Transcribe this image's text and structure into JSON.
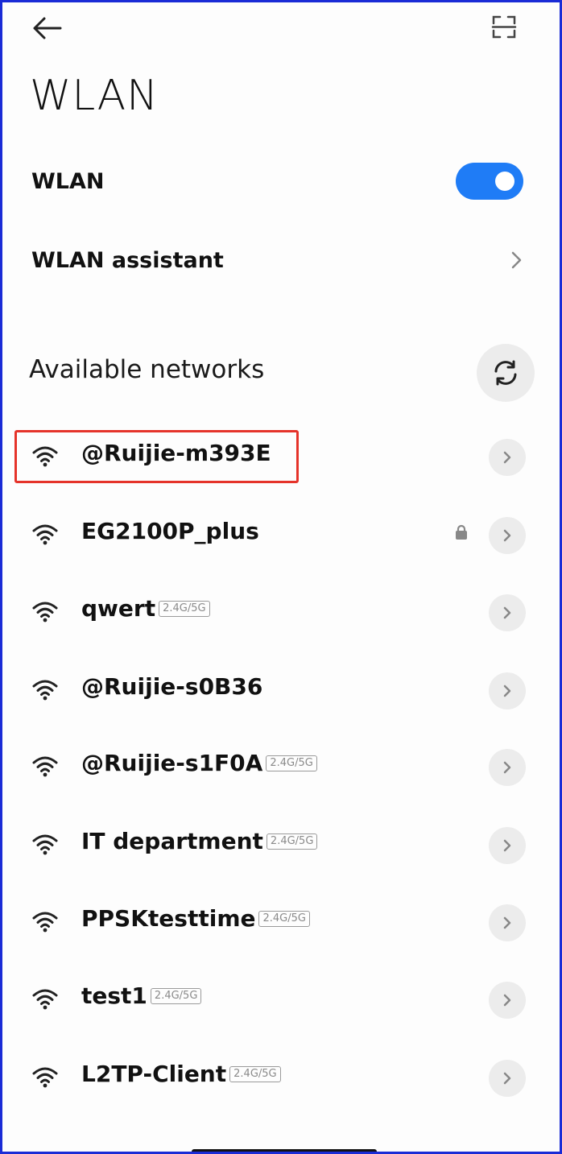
{
  "page": {
    "title": "WLAN"
  },
  "wlan_toggle": {
    "label": "WLAN",
    "on": true
  },
  "assistant": {
    "label": "WLAN assistant"
  },
  "available": {
    "title": "Available networks"
  },
  "networks": [
    {
      "name": "@Ruijie-m393E",
      "band": "",
      "locked": false,
      "highlighted": true
    },
    {
      "name": "EG2100P_plus",
      "band": "",
      "locked": true,
      "highlighted": false
    },
    {
      "name": "qwert",
      "band": "2.4G/5G",
      "locked": false,
      "highlighted": false
    },
    {
      "name": "@Ruijie-s0B36",
      "band": "",
      "locked": false,
      "highlighted": false
    },
    {
      "name": "@Ruijie-s1F0A",
      "band": "2.4G/5G",
      "locked": false,
      "highlighted": false
    },
    {
      "name": "IT department",
      "band": "2.4G/5G",
      "locked": false,
      "highlighted": false
    },
    {
      "name": "PPSKtesttime",
      "band": "2.4G/5G",
      "locked": false,
      "highlighted": false
    },
    {
      "name": "test1",
      "band": "2.4G/5G",
      "locked": false,
      "highlighted": false
    },
    {
      "name": "L2TP-Client",
      "band": "2.4G/5G",
      "locked": false,
      "highlighted": false
    }
  ],
  "colors": {
    "accent": "#1f7cf6",
    "highlight": "#e5332a",
    "frame": "#1a2bd6"
  },
  "icons": {
    "back": "arrow-left-icon",
    "scan": "scan-frame-icon",
    "refresh": "refresh-icon",
    "wifi": "wifi-icon",
    "lock": "lock-icon",
    "chevron": "chevron-right-icon"
  }
}
